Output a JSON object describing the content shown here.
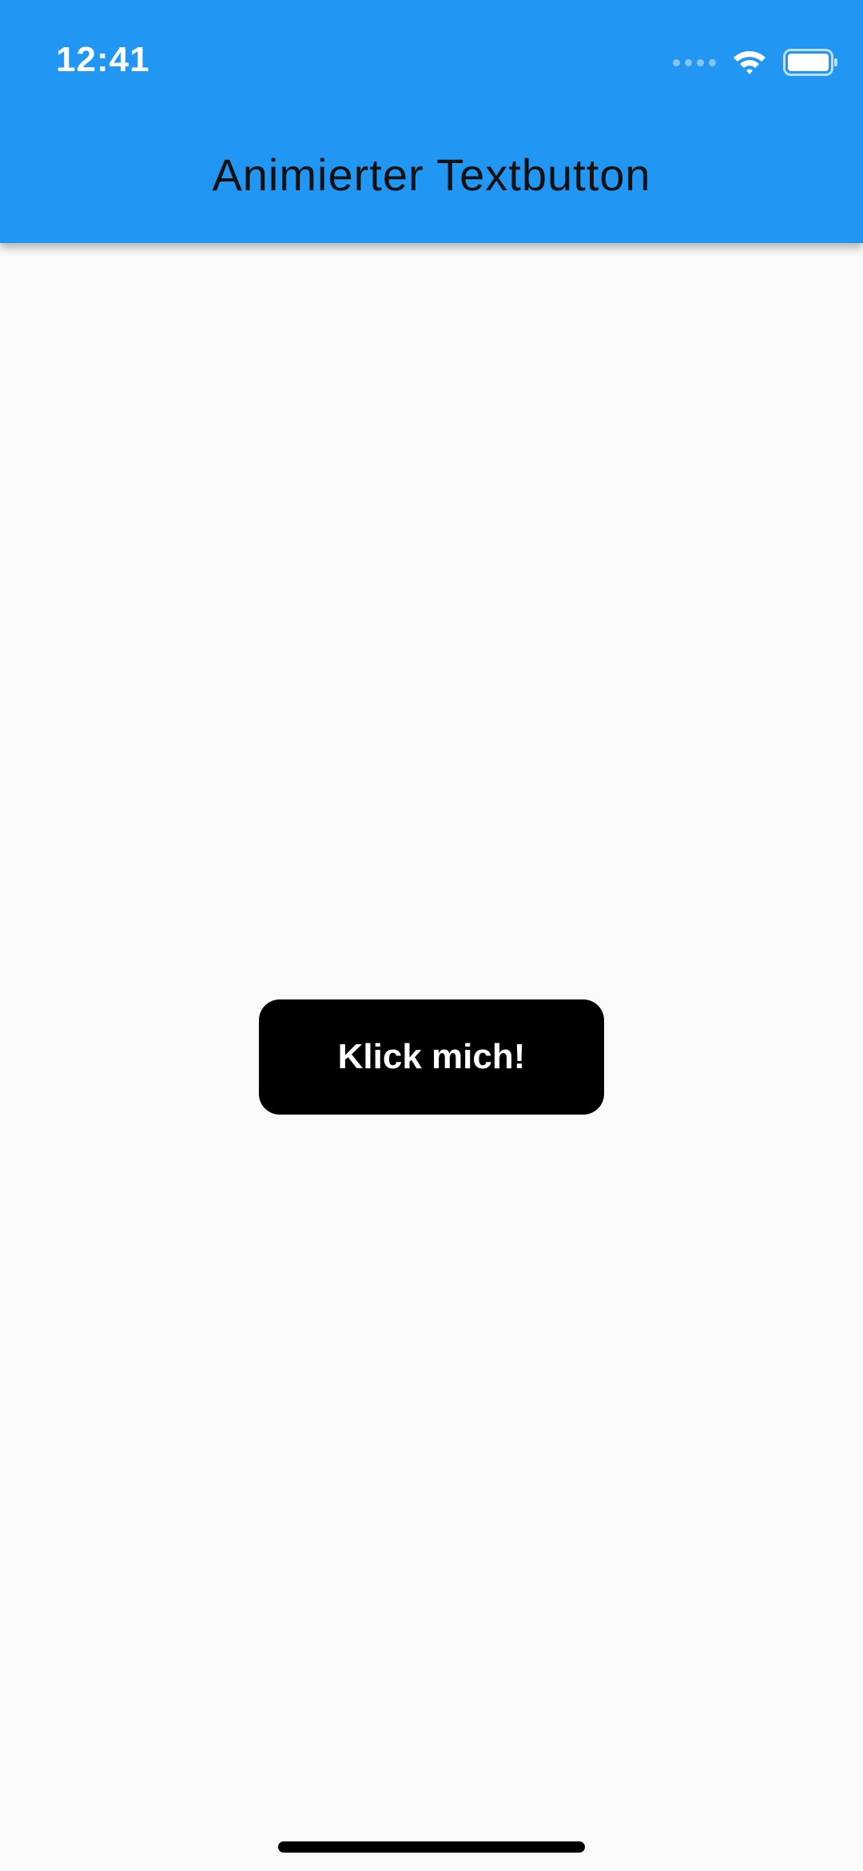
{
  "status_bar": {
    "time": "12:41",
    "icons": [
      "cellular-signal-icon",
      "wifi-icon",
      "battery-icon"
    ]
  },
  "app_bar": {
    "title": "Animierter Textbutton",
    "background_color": "#2196f3",
    "title_color": "#111111"
  },
  "main": {
    "button_label": "Klick mich!",
    "button_color": "#000000",
    "button_text_color": "#ffffff",
    "background_color": "#fafafa"
  }
}
